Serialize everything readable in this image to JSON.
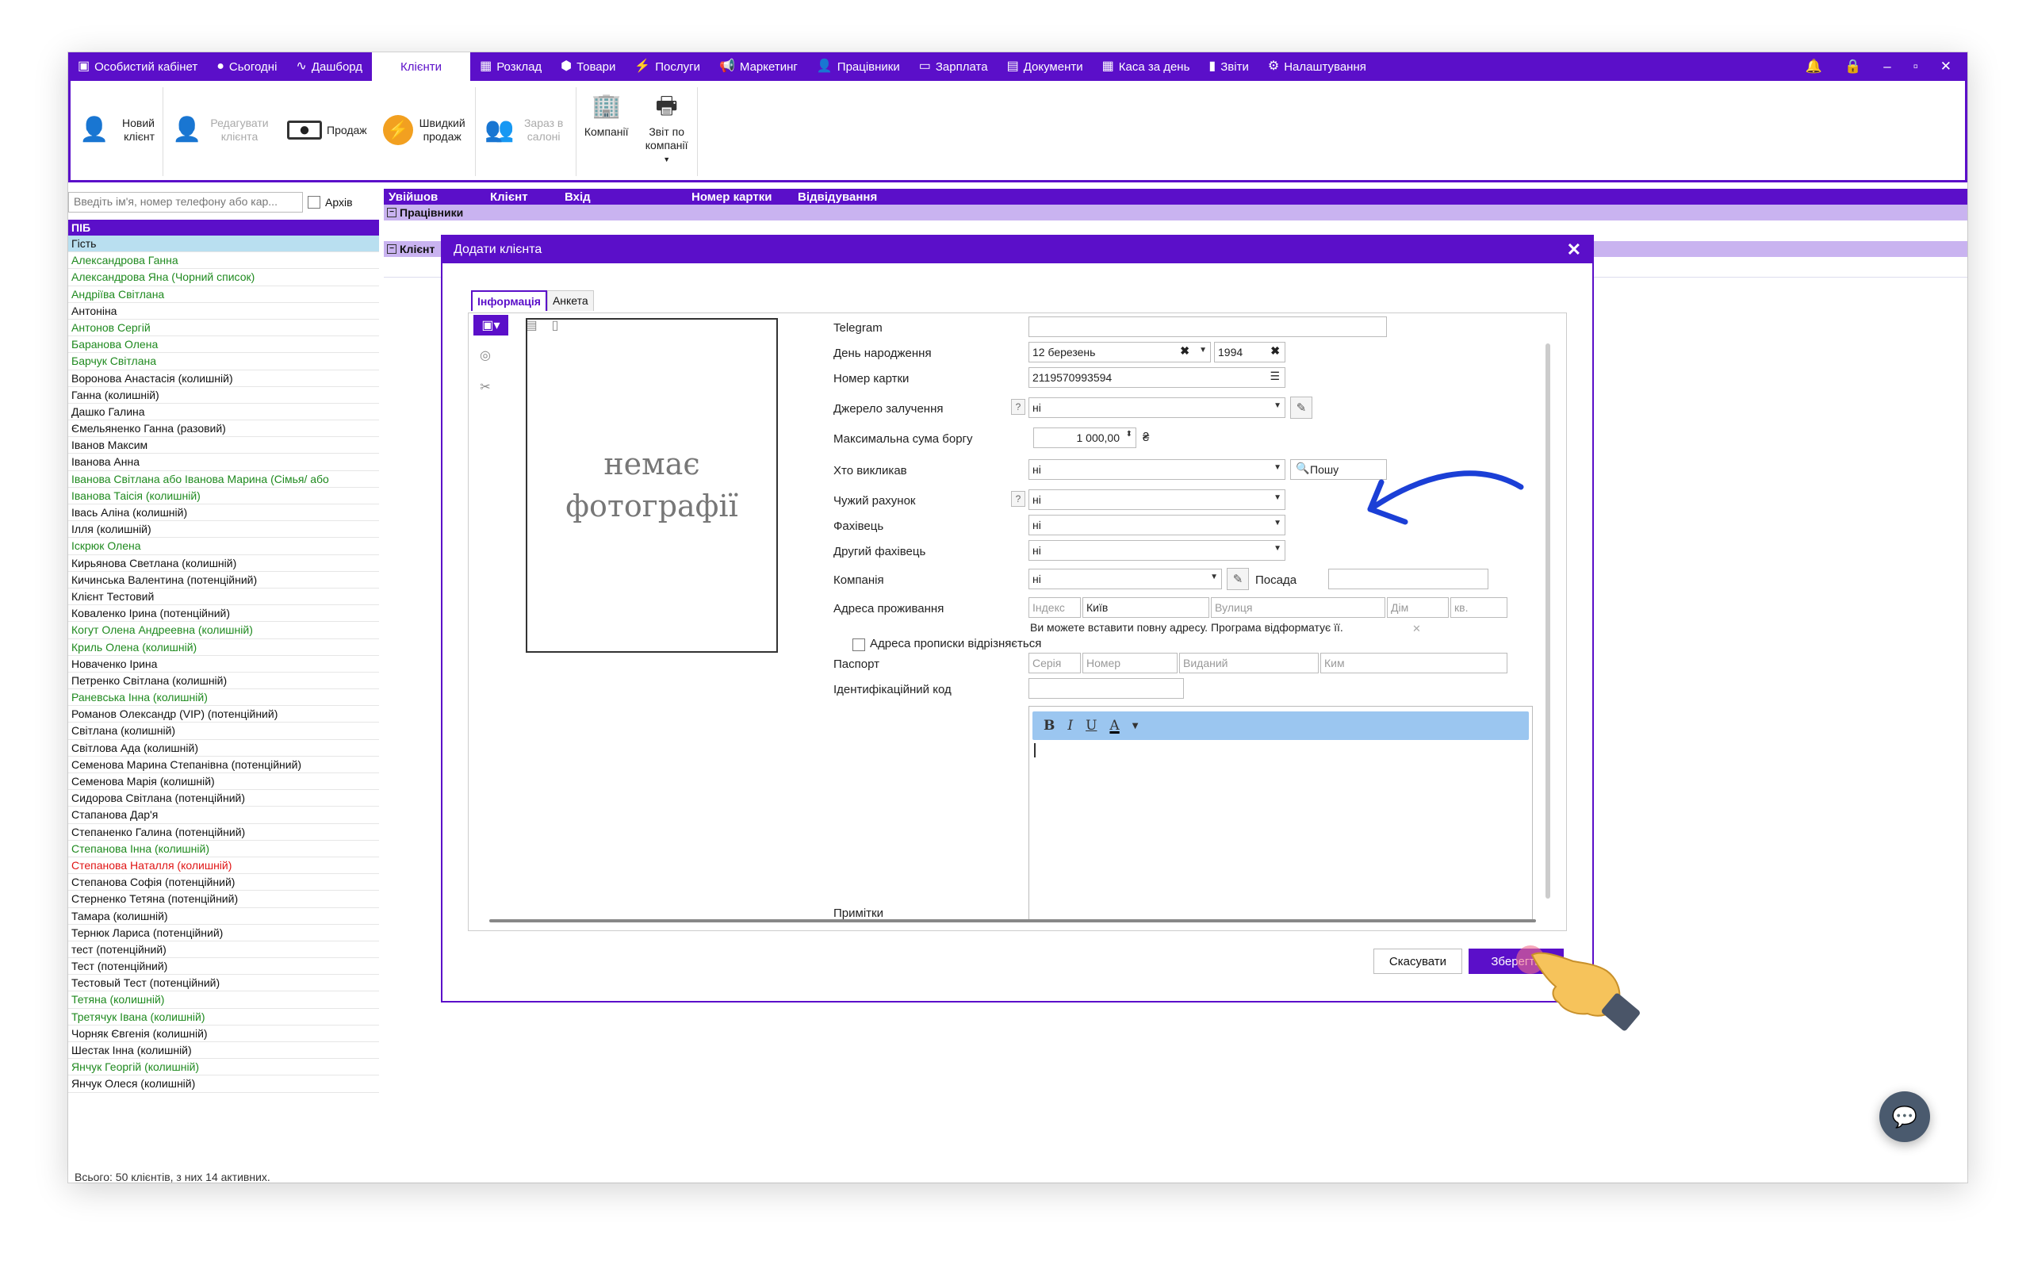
{
  "menu": {
    "items": [
      {
        "icon": "wallet-icon",
        "glyph": "▣",
        "label": "Особистий кабінет"
      },
      {
        "icon": "circle-icon",
        "glyph": "●",
        "label": "Сьогодні"
      },
      {
        "icon": "pulse-icon",
        "glyph": "∿",
        "label": "Дашборд"
      },
      {
        "icon": "",
        "glyph": "",
        "label": "Клієнти"
      },
      {
        "icon": "calendar-icon",
        "glyph": "▦",
        "label": "Розклад"
      },
      {
        "icon": "box-icon",
        "glyph": "⬢",
        "label": "Товари"
      },
      {
        "icon": "bolt-icon",
        "glyph": "⚡",
        "label": "Послуги"
      },
      {
        "icon": "megaphone-icon",
        "glyph": "📢",
        "label": "Маркетинг"
      },
      {
        "icon": "person-icon",
        "glyph": "👤",
        "label": "Працівники"
      },
      {
        "icon": "money-icon",
        "glyph": "▭",
        "label": "Зарплата"
      },
      {
        "icon": "document-icon",
        "glyph": "▤",
        "label": "Документи"
      },
      {
        "icon": "calculator-icon",
        "glyph": "▦",
        "label": "Каса за день"
      },
      {
        "icon": "bar-chart-icon",
        "glyph": "▮",
        "label": "Звіти"
      },
      {
        "icon": "gear-icon",
        "glyph": "⚙",
        "label": "Налаштування"
      }
    ]
  },
  "ribbon": {
    "new_client": "Новий клієнт",
    "edit_client": "Редагувати клієнта",
    "sale": "Продаж",
    "quick_sale": "Швидкий продаж",
    "in_salon": "Зараз в салоні",
    "companies": "Компанії",
    "company_report": "Звіт по компанії"
  },
  "search": {
    "placeholder": "Введіть ім'я, номер телефону або кар...",
    "archive": "Архів"
  },
  "list": {
    "header": "ПІБ",
    "items": [
      {
        "t": "Гість",
        "c": "sel"
      },
      {
        "t": "Александрова Ганна",
        "c": "g"
      },
      {
        "t": "Александрова Яна (Чорний список)",
        "c": "g"
      },
      {
        "t": "Андріїва Світлана",
        "c": "g"
      },
      {
        "t": "Антоніна",
        "c": ""
      },
      {
        "t": "Антонов Сергій",
        "c": "g"
      },
      {
        "t": "Баранова Олена",
        "c": "g"
      },
      {
        "t": "Барчук Світлана",
        "c": "g"
      },
      {
        "t": "Воронова Анастасія (колишній)",
        "c": ""
      },
      {
        "t": "Ганна (колишній)",
        "c": ""
      },
      {
        "t": "Дашко Галина",
        "c": ""
      },
      {
        "t": "Ємельяненко Ганна (разовий)",
        "c": ""
      },
      {
        "t": "Іванов Максим",
        "c": ""
      },
      {
        "t": "Іванова Анна",
        "c": ""
      },
      {
        "t": "Іванова Світлана  або Іванова  Марина (Сімья/  або",
        "c": "g"
      },
      {
        "t": "Іванова Таісія (колишній)",
        "c": "g"
      },
      {
        "t": "Івась Аліна (колишній)",
        "c": ""
      },
      {
        "t": "Ілля (колишній)",
        "c": ""
      },
      {
        "t": "Іскрюк Олена",
        "c": "g"
      },
      {
        "t": "Кирьянова Светлана (колишній)",
        "c": ""
      },
      {
        "t": "Кичинська Валентина (потенційний)",
        "c": ""
      },
      {
        "t": "Клієнт Тестовий",
        "c": ""
      },
      {
        "t": "Коваленко Ірина (потенційний)",
        "c": ""
      },
      {
        "t": "Когут Олена Андреевна (колишній)",
        "c": "g"
      },
      {
        "t": "Криль Олена (колишній)",
        "c": "g"
      },
      {
        "t": "Новаченко Ірина",
        "c": ""
      },
      {
        "t": "Петренко Світлана (колишній)",
        "c": ""
      },
      {
        "t": "Раневська Інна (колишній)",
        "c": "g"
      },
      {
        "t": "Романов Олександр (VIP) (потенційний)",
        "c": ""
      },
      {
        "t": "Світлана (колишній)",
        "c": ""
      },
      {
        "t": "Світлова Ада (колишній)",
        "c": ""
      },
      {
        "t": "Семенова Марина Степанівна (потенційний)",
        "c": ""
      },
      {
        "t": "Семенова Марія (колишній)",
        "c": ""
      },
      {
        "t": "Сидорова Світлана (потенційний)",
        "c": ""
      },
      {
        "t": "Стапанова Дар'я",
        "c": ""
      },
      {
        "t": "Степаненко Галина (потенційний)",
        "c": ""
      },
      {
        "t": "Степанова Інна (колишній)",
        "c": "g"
      },
      {
        "t": "Степанова Наталля (колишній)",
        "c": "r"
      },
      {
        "t": "Степанова Софія (потенційний)",
        "c": ""
      },
      {
        "t": "Стерненко Тетяна (потенційний)",
        "c": ""
      },
      {
        "t": "Тамара (колишній)",
        "c": ""
      },
      {
        "t": "Тернюк Лариса (потенційний)",
        "c": ""
      },
      {
        "t": "тест (потенційний)",
        "c": ""
      },
      {
        "t": "Тест (потенційний)",
        "c": ""
      },
      {
        "t": "Тестовый Тест (потенційний)",
        "c": ""
      },
      {
        "t": "Тетяна (колишній)",
        "c": "g"
      },
      {
        "t": "Третячук Івана (колишній)",
        "c": "g"
      },
      {
        "t": "Чорняк Євгенія (колишній)",
        "c": ""
      },
      {
        "t": "Шестак Інна (колишній)",
        "c": ""
      },
      {
        "t": "Янчук Георгій (колишній)",
        "c": "g"
      },
      {
        "t": "Янчук Олеся (колишній)",
        "c": ""
      }
    ]
  },
  "grid": {
    "cols": [
      "Увійшов",
      "Клієнт",
      "Вхід",
      "Номер картки",
      "Відвідування"
    ],
    "group1": "Працівники",
    "group2": "Клієнт"
  },
  "status": "Всього: 50 клієнтів, з них 14 активних.",
  "dialog": {
    "title": "Додати клієнта",
    "tab_info": "Інформація",
    "tab_form": "Анкета",
    "no_photo": "немає фотографії",
    "labels": {
      "telegram": "Telegram",
      "birthday": "День народження",
      "card": "Номер картки",
      "source": "Джерело залучення",
      "max_debt": "Максимальна сума боргу",
      "who_called": "Хто викликав",
      "foreign": "Чужий рахунок",
      "spec": "Фахівець",
      "spec2": "Другий фахівець",
      "company": "Компанія",
      "position": "Посада",
      "address": "Адреса проживання",
      "reg_diff": "Адреса прописки відрізняється",
      "passport": "Паспорт",
      "id_code": "Ідентифікаційний код",
      "notes": "Примітки"
    },
    "values": {
      "bday_day": "12 березень",
      "bday_year": "1994",
      "card": "2119570993594",
      "source": "ні",
      "max_debt": "1 000,00",
      "currency": "₴",
      "who_called": "ні",
      "search_btn": "Пошу",
      "foreign": "ні",
      "spec": "ні",
      "spec2": "ні",
      "company": "ні",
      "city": "Київ"
    },
    "placeholders": {
      "index": "Індекс",
      "street": "Вулиця",
      "house": "Дім",
      "apt": "кв.",
      "series": "Серія",
      "number": "Номер",
      "issued": "Виданий",
      "by_whom": "Ким"
    },
    "address_hint": "Ви можете вставити повну адресу. Програма відформатує її.",
    "cancel": "Скасувати",
    "save": "Зберегти"
  }
}
